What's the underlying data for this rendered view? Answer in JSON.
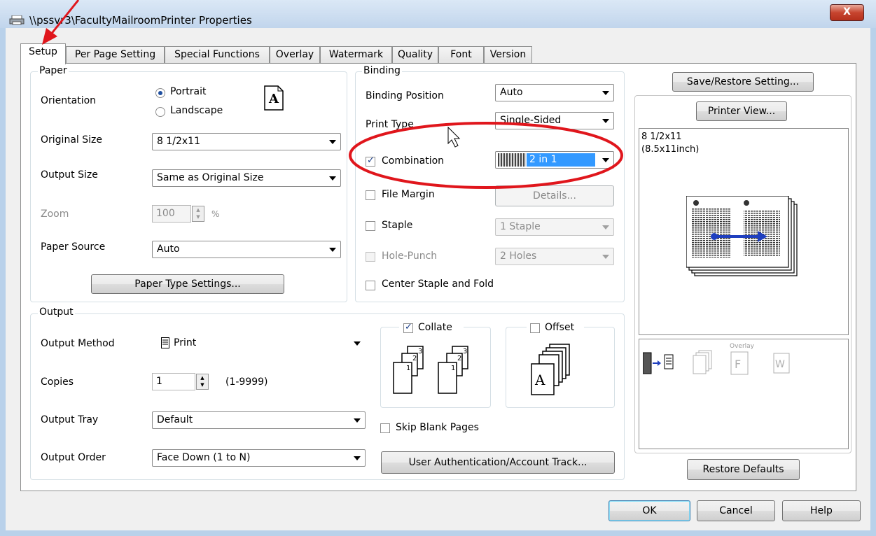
{
  "window": {
    "title": "\\\\pssvr3\\FacultyMailroomPrinter Properties",
    "close_label": "X"
  },
  "tabs": [
    {
      "label": "Setup"
    },
    {
      "label": "Per Page Setting"
    },
    {
      "label": "Special Functions"
    },
    {
      "label": "Overlay"
    },
    {
      "label": "Watermark"
    },
    {
      "label": "Quality"
    },
    {
      "label": "Font"
    },
    {
      "label": "Version"
    }
  ],
  "paper": {
    "legend": "Paper",
    "orientation_label": "Orientation",
    "portrait_label": "Portrait",
    "landscape_label": "Landscape",
    "orientation_icon_letter": "A",
    "original_size_label": "Original Size",
    "original_size_value": "8 1/2x11",
    "output_size_label": "Output Size",
    "output_size_value": "Same as Original Size",
    "zoom_label": "Zoom",
    "zoom_value": "100",
    "zoom_unit": "%",
    "paper_source_label": "Paper Source",
    "paper_source_value": "Auto",
    "paper_type_button": "Paper Type Settings..."
  },
  "binding": {
    "legend": "Binding",
    "binding_position_label": "Binding Position",
    "binding_position_value": "Auto",
    "print_type_label": "Print Type",
    "print_type_value": "Single-Sided",
    "combination_label": "Combination",
    "combination_value": "2 in 1",
    "file_margin_label": "File Margin",
    "details_button": "Details...",
    "staple_label": "Staple",
    "staple_value": "1 Staple",
    "hole_punch_label": "Hole-Punch",
    "hole_punch_value": "2 Holes",
    "center_staple_label": "Center Staple and Fold"
  },
  "output": {
    "legend": "Output",
    "output_method_label": "Output Method",
    "output_method_value": "Print",
    "copies_label": "Copies",
    "copies_value": "1",
    "copies_range": "(1-9999)",
    "output_tray_label": "Output Tray",
    "output_tray_value": "Default",
    "output_order_label": "Output Order",
    "output_order_value": "Face Down (1 to N)",
    "collate_label": "Collate",
    "offset_label": "Offset",
    "skip_blank_label": "Skip Blank Pages",
    "user_auth_button": "User Authentication/Account Track..."
  },
  "preview": {
    "save_restore_button": "Save/Restore Setting...",
    "printer_view_button": "Printer View...",
    "paper_size_line1": "8 1/2x11",
    "paper_size_line2": "(8.5x11inch)",
    "overlay_label": "Overlay",
    "restore_defaults_button": "Restore Defaults"
  },
  "footer": {
    "ok_button": "OK",
    "cancel_button": "Cancel",
    "help_button": "Help"
  },
  "colors": {
    "annotation_red": "#e0161c",
    "selection_blue": "#3399ff"
  }
}
